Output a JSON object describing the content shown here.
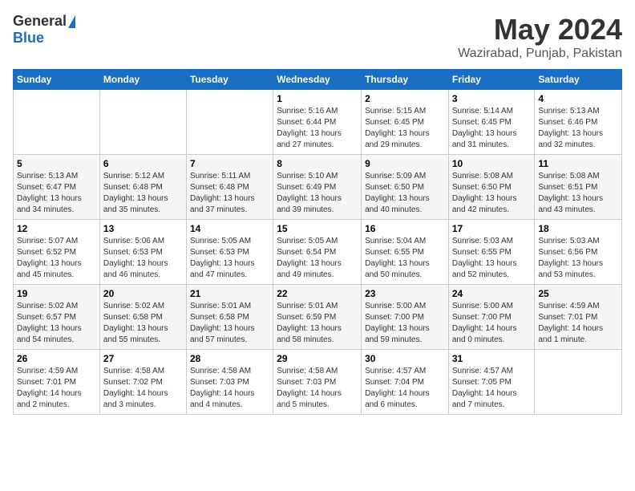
{
  "logo": {
    "general": "General",
    "blue": "Blue"
  },
  "title": {
    "month": "May 2024",
    "location": "Wazirabad, Punjab, Pakistan"
  },
  "days_of_week": [
    "Sunday",
    "Monday",
    "Tuesday",
    "Wednesday",
    "Thursday",
    "Friday",
    "Saturday"
  ],
  "weeks": [
    [
      {
        "day": "",
        "info": ""
      },
      {
        "day": "",
        "info": ""
      },
      {
        "day": "",
        "info": ""
      },
      {
        "day": "1",
        "info": "Sunrise: 5:16 AM\nSunset: 6:44 PM\nDaylight: 13 hours\nand 27 minutes."
      },
      {
        "day": "2",
        "info": "Sunrise: 5:15 AM\nSunset: 6:45 PM\nDaylight: 13 hours\nand 29 minutes."
      },
      {
        "day": "3",
        "info": "Sunrise: 5:14 AM\nSunset: 6:45 PM\nDaylight: 13 hours\nand 31 minutes."
      },
      {
        "day": "4",
        "info": "Sunrise: 5:13 AM\nSunset: 6:46 PM\nDaylight: 13 hours\nand 32 minutes."
      }
    ],
    [
      {
        "day": "5",
        "info": "Sunrise: 5:13 AM\nSunset: 6:47 PM\nDaylight: 13 hours\nand 34 minutes."
      },
      {
        "day": "6",
        "info": "Sunrise: 5:12 AM\nSunset: 6:48 PM\nDaylight: 13 hours\nand 35 minutes."
      },
      {
        "day": "7",
        "info": "Sunrise: 5:11 AM\nSunset: 6:48 PM\nDaylight: 13 hours\nand 37 minutes."
      },
      {
        "day": "8",
        "info": "Sunrise: 5:10 AM\nSunset: 6:49 PM\nDaylight: 13 hours\nand 39 minutes."
      },
      {
        "day": "9",
        "info": "Sunrise: 5:09 AM\nSunset: 6:50 PM\nDaylight: 13 hours\nand 40 minutes."
      },
      {
        "day": "10",
        "info": "Sunrise: 5:08 AM\nSunset: 6:50 PM\nDaylight: 13 hours\nand 42 minutes."
      },
      {
        "day": "11",
        "info": "Sunrise: 5:08 AM\nSunset: 6:51 PM\nDaylight: 13 hours\nand 43 minutes."
      }
    ],
    [
      {
        "day": "12",
        "info": "Sunrise: 5:07 AM\nSunset: 6:52 PM\nDaylight: 13 hours\nand 45 minutes."
      },
      {
        "day": "13",
        "info": "Sunrise: 5:06 AM\nSunset: 6:53 PM\nDaylight: 13 hours\nand 46 minutes."
      },
      {
        "day": "14",
        "info": "Sunrise: 5:05 AM\nSunset: 6:53 PM\nDaylight: 13 hours\nand 47 minutes."
      },
      {
        "day": "15",
        "info": "Sunrise: 5:05 AM\nSunset: 6:54 PM\nDaylight: 13 hours\nand 49 minutes."
      },
      {
        "day": "16",
        "info": "Sunrise: 5:04 AM\nSunset: 6:55 PM\nDaylight: 13 hours\nand 50 minutes."
      },
      {
        "day": "17",
        "info": "Sunrise: 5:03 AM\nSunset: 6:55 PM\nDaylight: 13 hours\nand 52 minutes."
      },
      {
        "day": "18",
        "info": "Sunrise: 5:03 AM\nSunset: 6:56 PM\nDaylight: 13 hours\nand 53 minutes."
      }
    ],
    [
      {
        "day": "19",
        "info": "Sunrise: 5:02 AM\nSunset: 6:57 PM\nDaylight: 13 hours\nand 54 minutes."
      },
      {
        "day": "20",
        "info": "Sunrise: 5:02 AM\nSunset: 6:58 PM\nDaylight: 13 hours\nand 55 minutes."
      },
      {
        "day": "21",
        "info": "Sunrise: 5:01 AM\nSunset: 6:58 PM\nDaylight: 13 hours\nand 57 minutes."
      },
      {
        "day": "22",
        "info": "Sunrise: 5:01 AM\nSunset: 6:59 PM\nDaylight: 13 hours\nand 58 minutes."
      },
      {
        "day": "23",
        "info": "Sunrise: 5:00 AM\nSunset: 7:00 PM\nDaylight: 13 hours\nand 59 minutes."
      },
      {
        "day": "24",
        "info": "Sunrise: 5:00 AM\nSunset: 7:00 PM\nDaylight: 14 hours\nand 0 minutes."
      },
      {
        "day": "25",
        "info": "Sunrise: 4:59 AM\nSunset: 7:01 PM\nDaylight: 14 hours\nand 1 minute."
      }
    ],
    [
      {
        "day": "26",
        "info": "Sunrise: 4:59 AM\nSunset: 7:01 PM\nDaylight: 14 hours\nand 2 minutes."
      },
      {
        "day": "27",
        "info": "Sunrise: 4:58 AM\nSunset: 7:02 PM\nDaylight: 14 hours\nand 3 minutes."
      },
      {
        "day": "28",
        "info": "Sunrise: 4:58 AM\nSunset: 7:03 PM\nDaylight: 14 hours\nand 4 minutes."
      },
      {
        "day": "29",
        "info": "Sunrise: 4:58 AM\nSunset: 7:03 PM\nDaylight: 14 hours\nand 5 minutes."
      },
      {
        "day": "30",
        "info": "Sunrise: 4:57 AM\nSunset: 7:04 PM\nDaylight: 14 hours\nand 6 minutes."
      },
      {
        "day": "31",
        "info": "Sunrise: 4:57 AM\nSunset: 7:05 PM\nDaylight: 14 hours\nand 7 minutes."
      },
      {
        "day": "",
        "info": ""
      }
    ]
  ]
}
